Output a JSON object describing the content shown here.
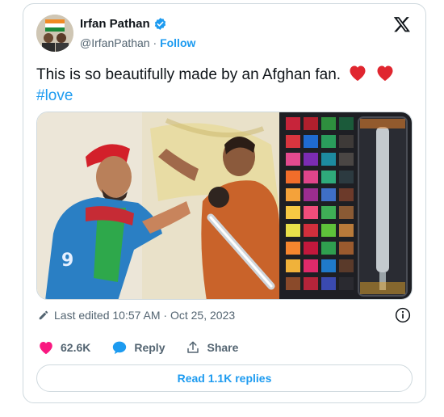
{
  "author": {
    "name": "Irfan Pathan",
    "handle": "@IrfanPathan",
    "separator": "·",
    "follow_label": "Follow",
    "verified_color": "#1d9bf0"
  },
  "tweet": {
    "text": "This is so beautifully made by an Afghan fan.",
    "hashtag": "#love",
    "emojis": [
      "red-heart",
      "red-heart"
    ]
  },
  "meta": {
    "edited_label": "Last edited 10:57 AM · Oct 25, 2023"
  },
  "stats": {
    "likes": "62.6K",
    "reply_label": "Reply",
    "share_label": "Share"
  },
  "footer": {
    "read_replies_label": "Read 1.1K replies"
  },
  "colors": {
    "accent": "#1d9bf0",
    "like": "#f91880",
    "muted": "#536471",
    "text": "#0f1419"
  }
}
